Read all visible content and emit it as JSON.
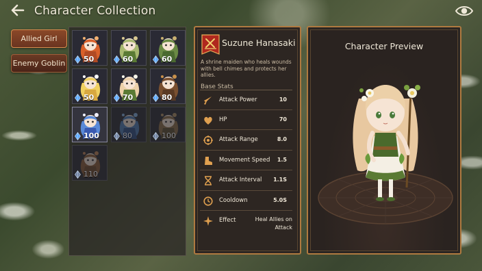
{
  "header": {
    "title": "Character Collection",
    "back_icon": "back-arrow-icon",
    "visibility_icon": "eye-icon"
  },
  "tabs": [
    {
      "label": "Allied Girl",
      "active": true
    },
    {
      "label": "Enemy Goblin",
      "active": false
    }
  ],
  "characters": [
    {
      "cost": "50",
      "locked": false,
      "selected": false,
      "theme": "fox-warrior"
    },
    {
      "cost": "60",
      "locked": false,
      "selected": false,
      "theme": "leaf-archer"
    },
    {
      "cost": "60",
      "locked": false,
      "selected": false,
      "theme": "hooded-shield"
    },
    {
      "cost": "50",
      "locked": false,
      "selected": false,
      "theme": "golden-valkyrie"
    },
    {
      "cost": "70",
      "locked": false,
      "selected": false,
      "theme": "shrine-maiden"
    },
    {
      "cost": "80",
      "locked": false,
      "selected": false,
      "theme": "raccoon-girl"
    },
    {
      "cost": "100",
      "locked": false,
      "selected": true,
      "theme": "bunny-mage"
    },
    {
      "cost": "80",
      "locked": true,
      "selected": false,
      "theme": "blue-mage"
    },
    {
      "cost": "100",
      "locked": true,
      "selected": false,
      "theme": "brown-warrior"
    },
    {
      "cost": "110",
      "locked": true,
      "selected": false,
      "theme": "squirrel-girl"
    }
  ],
  "info": {
    "name": "Suzune Hanasaki",
    "description": "A shrine maiden who heals wounds with bell chimes and protects her allies.",
    "stats_title": "Base Stats",
    "stats": [
      {
        "label": "Attack Power",
        "value": "10",
        "icon": "sword-icon"
      },
      {
        "label": "HP",
        "value": "70",
        "icon": "heart-icon"
      },
      {
        "label": "Attack Range",
        "value": "8.0",
        "icon": "target-icon"
      },
      {
        "label": "Movement Speed",
        "value": "1.5",
        "icon": "boot-icon"
      },
      {
        "label": "Attack Interval",
        "value": "1.1S",
        "icon": "hourglass-icon"
      },
      {
        "label": "Cooldown",
        "value": "5.0S",
        "icon": "clock-icon"
      }
    ],
    "effect": {
      "label": "Effect",
      "value": "Heal Allies on Attack",
      "icon": "sparkle-icon"
    }
  },
  "preview": {
    "title": "Character Preview"
  },
  "colors": {
    "accent_border": "#b07a40",
    "tab_active": "#8a4828",
    "crystal": "#5aa8ff"
  }
}
